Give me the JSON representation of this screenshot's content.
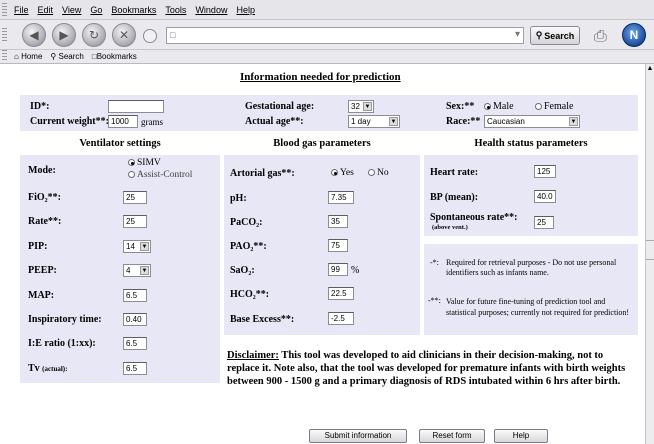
{
  "browser": {
    "menu": [
      "File",
      "Edit",
      "View",
      "Go",
      "Bookmarks",
      "Tools",
      "Window",
      "Help"
    ],
    "search_label": "Search",
    "bookmarks_bar": [
      "Home",
      "Search",
      "Bookmarks"
    ]
  },
  "page": {
    "title": "Information needed for prediction",
    "id_label": "ID*:",
    "weight_label": "Current weight**:",
    "weight_value": "1000",
    "weight_unit": "grams",
    "gest_label": "Gestational age:",
    "gest_value": "32",
    "actual_label": "Actual age**:",
    "actual_value": "1 day",
    "sex_label": "Sex:**",
    "sex_male": "Male",
    "sex_female": "Female",
    "race_label": "Race:**",
    "race_value": "Caucasian"
  },
  "ventilator": {
    "header": "Ventilator settings",
    "mode_label": "Mode:",
    "mode_simv": "SIMV",
    "mode_assist": "Assist-Control",
    "fio2_label": "FiO₂**:",
    "fio2_value": "25",
    "rate_label": "Rate**:",
    "rate_value": "25",
    "pip_label": "PIP:",
    "pip_value": "14",
    "peep_label": "PEEP:",
    "peep_value": "4",
    "map_label": "MAP:",
    "map_value": "6.5",
    "insp_label": "Inspiratory time:",
    "insp_value": "0.40",
    "ie_label": "I:E ratio (1:xx):",
    "ie_value": "6.5",
    "tv_label": "Tv",
    "tv_sub": "(actual):",
    "tv_value": "6.5"
  },
  "bloodgas": {
    "header": "Blood gas parameters",
    "arterial_label": "Artorial gas**:",
    "yes": "Yes",
    "no": "No",
    "ph_label": "pH:",
    "ph_value": "7.35",
    "paco2_label": "PaCO₂:",
    "paco2_value": "35",
    "pao2_label": "PAO₂**:",
    "pao2_value": "75",
    "sao2_label": "SaO₂:",
    "sao2_value": "99",
    "sao2_unit": "%",
    "hco2_label": "HCO₂**:",
    "hco2_value": "22.5",
    "be_label": "Base Excess**:",
    "be_value": "-2.5"
  },
  "health": {
    "header": "Health status parameters",
    "hr_label": "Heart rate:",
    "hr_value": "125",
    "bp_label": "BP (mean):",
    "bp_value": "40.0",
    "spont_label": "Spontaneous rate**:",
    "spont_sub": "(above vent.)",
    "spont_value": "25",
    "note1_mark": "-*:",
    "note1": "Required for retrieval purposes - Do not use personal identifiers such as infants name.",
    "note2_mark": "-**:",
    "note2": "Value for future fine-tuning of prediction tool and statistical purposes; currently not required for prediction!"
  },
  "disclaimer": {
    "label": "Disclaimer:",
    "text": " This tool was developed to aid clinicians in their decision-making, not to replace it. Note also, that the tool was developed for premature infants with birth weights between 900 - 1500 g and a primary diagnosis of RDS intubated within 6 hrs after birth."
  },
  "actions": {
    "submit": "Submit information",
    "reset": "Reset form",
    "help": "Help"
  }
}
